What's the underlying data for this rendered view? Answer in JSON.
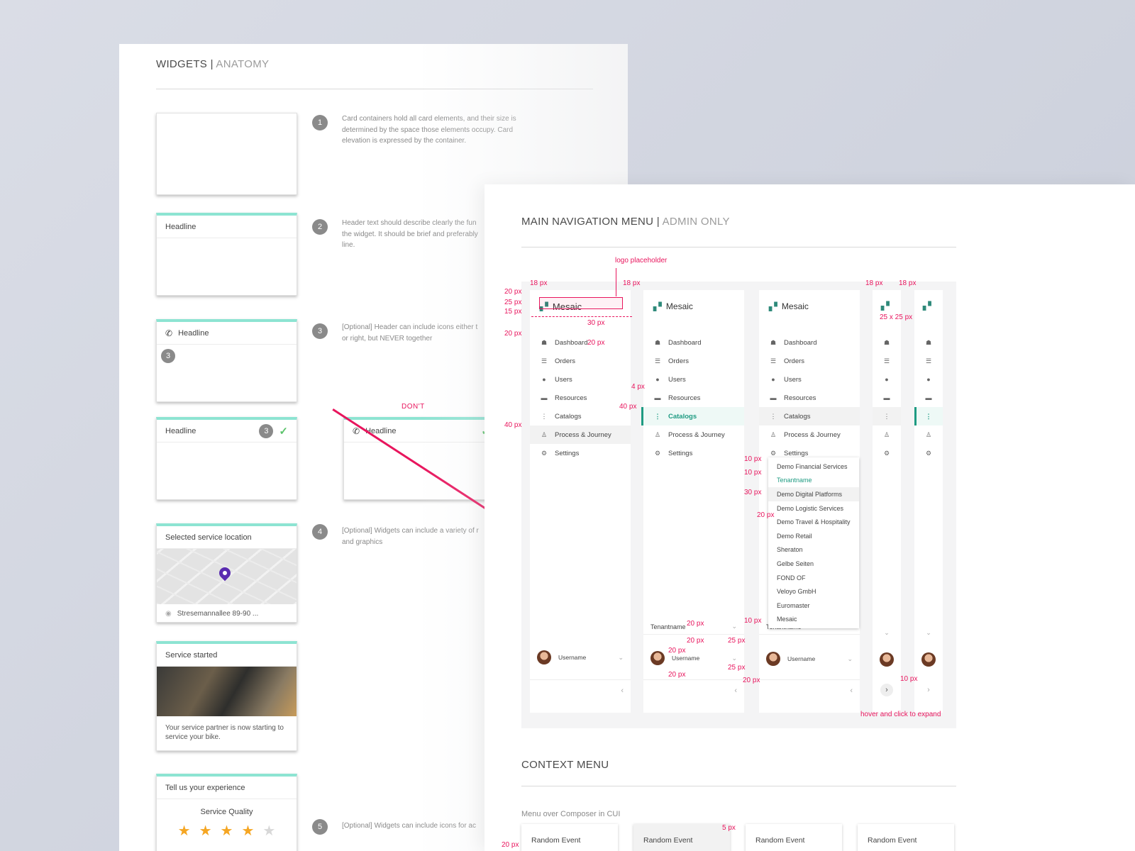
{
  "widgets": {
    "title": "WIDGETS",
    "title_muted": "ANATOMY",
    "steps": [
      {
        "num": "1",
        "text": "Card containers hold all card elements, and their size is determined by the space those elements occupy. Card elevation is expressed by the container."
      },
      {
        "num": "2",
        "text": "Header text should describe clearly the fun the widget. It should be brief and preferably line."
      },
      {
        "num": "3",
        "text": "[Optional] Header can include icons either t or right, but NEVER together"
      },
      {
        "num": "4",
        "text": "[Optional] Widgets can include a variety of r and graphics"
      },
      {
        "num": "5",
        "text": "[Optional] Widgets can include icons for ac"
      }
    ],
    "headline": "Headline",
    "badge": "3",
    "dont": "DON'T",
    "map_card": {
      "title": "Selected service location",
      "address": "Stresemannallee 89-90 ..."
    },
    "service_card": {
      "title": "Service started",
      "body": "Your service partner is now starting to service your bike."
    },
    "rating_card": {
      "title": "Tell us your experience",
      "label": "Service Quality",
      "rating": 4,
      "max": 5
    }
  },
  "nav": {
    "title": "MAIN NAVIGATION MENU",
    "title_muted": "ADMIN ONLY",
    "logo_text": "Mesaic",
    "items": [
      "Dashboard",
      "Orders",
      "Users",
      "Resources",
      "Catalogs",
      "Process & Journey",
      "Settings"
    ],
    "tenant_label": "Tenantname",
    "user_label": "Username",
    "tenants": [
      "Demo Financial Services",
      "Tenantname",
      "Demo Digital Platforms",
      "Demo Logistic Services",
      "Demo Travel & Hospitality",
      "Demo Retail",
      "Sheraton",
      "Gelbe Seiten",
      "FOND OF",
      "Veloyo GmbH",
      "Euromaster",
      "Mesaic"
    ],
    "annotations": {
      "logo_placeholder": "logo placeholder",
      "px18": "18 px",
      "px20": "20 px",
      "px25": "25 px",
      "px15": "15 px",
      "px30": "30 px",
      "px4": "4 px",
      "px40": "40 px",
      "px10": "10 px",
      "px25x25": "25 x 25 px",
      "hover_expand": "hover and click to expand"
    }
  },
  "context": {
    "title": "CONTEXT MENU",
    "subtitle": "Menu over Composer in CUI",
    "items": [
      "Random Event",
      "Random Event",
      "Random Event",
      "Random Event"
    ],
    "annotations": {
      "px5": "5 px",
      "px20": "20 px"
    }
  },
  "colors": {
    "accent": "#1e9b82",
    "annotation": "#e8155d",
    "card_accent": "#8de4d2",
    "star": "#f5a623"
  }
}
